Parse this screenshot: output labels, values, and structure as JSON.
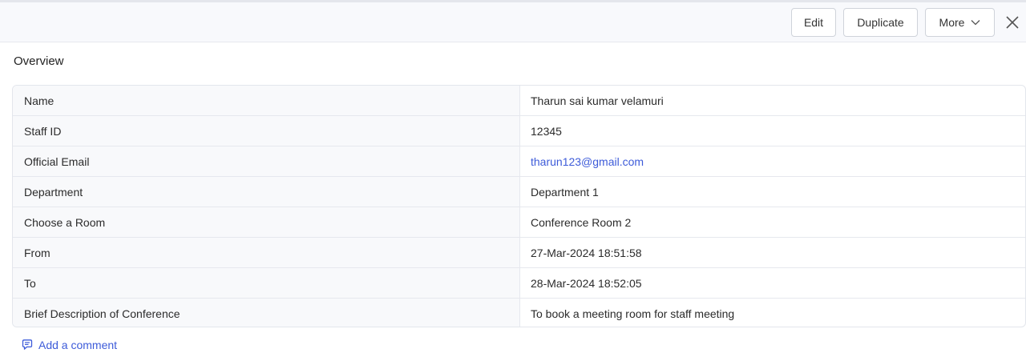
{
  "toolbar": {
    "edit_label": "Edit",
    "duplicate_label": "Duplicate",
    "more_label": "More"
  },
  "section_title": "Overview",
  "fields": [
    {
      "label": "Name",
      "value": "Tharun sai kumar velamuri"
    },
    {
      "label": "Staff ID",
      "value": "12345"
    },
    {
      "label": "Official Email",
      "value": "tharun123@gmail.com"
    },
    {
      "label": "Department",
      "value": "Department 1"
    },
    {
      "label": "Choose a Room",
      "value": "Conference Room 2"
    },
    {
      "label": "From",
      "value": "27-Mar-2024 18:51:58"
    },
    {
      "label": "To",
      "value": "28-Mar-2024 18:52:05"
    },
    {
      "label": "Brief Description of Conference",
      "value": "To book a meeting room for staff meeting"
    }
  ],
  "comment_label": "Add a comment",
  "colors": {
    "link": "#3d5bd9",
    "toolbar_bg": "#f8f9fc",
    "label_bg": "#f8f9fb"
  },
  "icons": {
    "more_chevron": "chevron-down-icon",
    "close": "close-icon",
    "comment": "comment-icon"
  }
}
